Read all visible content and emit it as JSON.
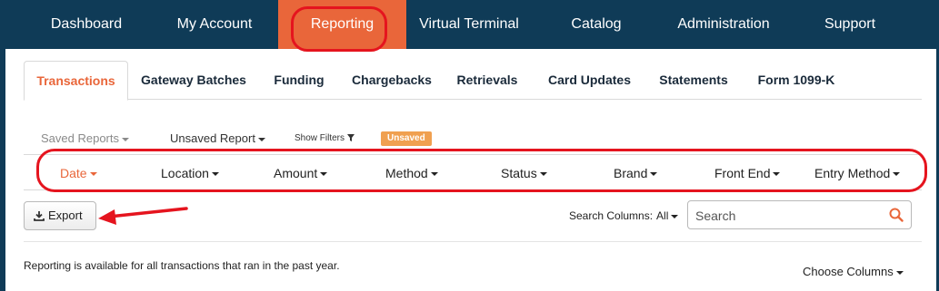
{
  "topnav": {
    "items": [
      {
        "label": "Dashboard"
      },
      {
        "label": "My Account"
      },
      {
        "label": "Reporting"
      },
      {
        "label": "Virtual Terminal"
      },
      {
        "label": "Catalog"
      },
      {
        "label": "Administration"
      },
      {
        "label": "Support"
      }
    ],
    "active": "Reporting"
  },
  "tabs": {
    "items": [
      {
        "label": "Transactions"
      },
      {
        "label": "Gateway Batches"
      },
      {
        "label": "Funding"
      },
      {
        "label": "Chargebacks"
      },
      {
        "label": "Retrievals"
      },
      {
        "label": "Card Updates"
      },
      {
        "label": "Statements"
      },
      {
        "label": "Form 1099-K"
      }
    ],
    "active": "Transactions"
  },
  "report_bar": {
    "saved_reports": "Saved Reports",
    "unsaved_report": "Unsaved Report",
    "show_filters": "Show Filters",
    "badge": "Unsaved"
  },
  "columns": {
    "items": [
      {
        "label": "Date"
      },
      {
        "label": "Location"
      },
      {
        "label": "Amount"
      },
      {
        "label": "Method"
      },
      {
        "label": "Status"
      },
      {
        "label": "Brand"
      },
      {
        "label": "Front End"
      },
      {
        "label": "Entry Method"
      }
    ],
    "active": "Date"
  },
  "toolbar": {
    "export_label": "Export",
    "search_columns_label": "Search Columns:",
    "search_columns_value": "All",
    "search_placeholder": "Search"
  },
  "info_text": "Reporting is available for all transactions that ran in the past year.",
  "choose_columns": "Choose Columns",
  "colors": {
    "nav_bg": "#0f3b57",
    "accent": "#e9663a",
    "annotation": "#e5141e",
    "badge": "#f0a050"
  },
  "icons": {
    "export": "download-icon",
    "search": "search-icon",
    "filter": "filter-icon"
  }
}
